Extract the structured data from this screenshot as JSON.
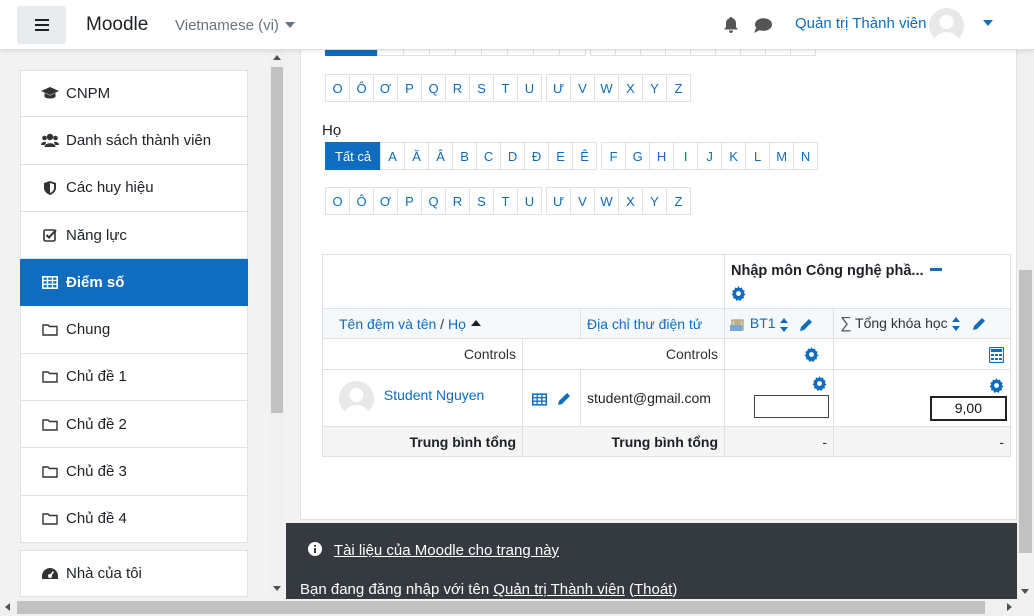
{
  "navbar": {
    "brand": "Moodle",
    "language": "Vietnamese (vi)",
    "user_name": "Quản trị Thành viên"
  },
  "sidebar": {
    "items": [
      {
        "label": "CNPM",
        "icon": "graduation-cap-icon"
      },
      {
        "label": "Danh sách thành viên",
        "icon": "users-icon"
      },
      {
        "label": "Các huy hiệu",
        "icon": "shield-icon"
      },
      {
        "label": "Năng lực",
        "icon": "checkbox-icon"
      },
      {
        "label": "Điểm số",
        "icon": "table-icon",
        "active": true
      },
      {
        "label": "Chung",
        "icon": "folder-icon"
      },
      {
        "label": "Chủ đề 1",
        "icon": "folder-icon"
      },
      {
        "label": "Chủ đề 2",
        "icon": "folder-icon"
      },
      {
        "label": "Chủ đề 3",
        "icon": "folder-icon"
      },
      {
        "label": "Chủ đề 4",
        "icon": "folder-icon"
      }
    ],
    "home": {
      "label": "Nhà của tôi",
      "icon": "dashboard-icon"
    }
  },
  "initials": {
    "row_bottom_letters": [
      "O",
      "Ô",
      "Ơ",
      "P",
      "Q",
      "R",
      "S",
      "T",
      "U",
      "Ư",
      "V",
      "W",
      "X",
      "Y",
      "Z"
    ],
    "ho_label": "Họ",
    "ho_all": "Tất cả",
    "ho_row1": [
      "A",
      "Ă",
      "Â",
      "B",
      "C",
      "D",
      "Đ",
      "E",
      "Ê",
      "F",
      "G",
      "H",
      "I",
      "J",
      "K",
      "L",
      "M",
      "N"
    ],
    "ho_row2": [
      "O",
      "Ô",
      "Ơ",
      "P",
      "Q",
      "R",
      "S",
      "T",
      "U",
      "Ư",
      "V",
      "W",
      "X",
      "Y",
      "Z"
    ]
  },
  "grader": {
    "course_name": "Nhập môn Công nghệ phầ...",
    "col_name": "Tên đệm và tên",
    "col_surname": "Họ",
    "col_email": "Địa chỉ thư điện tử",
    "col_bt1": "BT1",
    "col_total": "Tổng khóa học",
    "controls_1": "Controls",
    "controls_2": "Controls",
    "student_name": "Student Nguyen",
    "student_email": "student@gmail.com",
    "bt1_value": "",
    "total_value": "9,00",
    "avg_label_1": "Trung bình tổng",
    "avg_label_2": "Trung bình tổng",
    "avg_bt1": "-",
    "avg_total": "-"
  },
  "footer": {
    "docs_link": "Tài liệu của Moodle cho trang này",
    "logged_in_prefix": "Bạn đang đăng nhập với tên",
    "logged_user": "Quản trị Thành viên",
    "logout_open": "(",
    "logout": "Thoát",
    "logout_close": ")"
  },
  "colors": {
    "accent": "#0f6cbf",
    "footer_bg": "#343a40"
  }
}
